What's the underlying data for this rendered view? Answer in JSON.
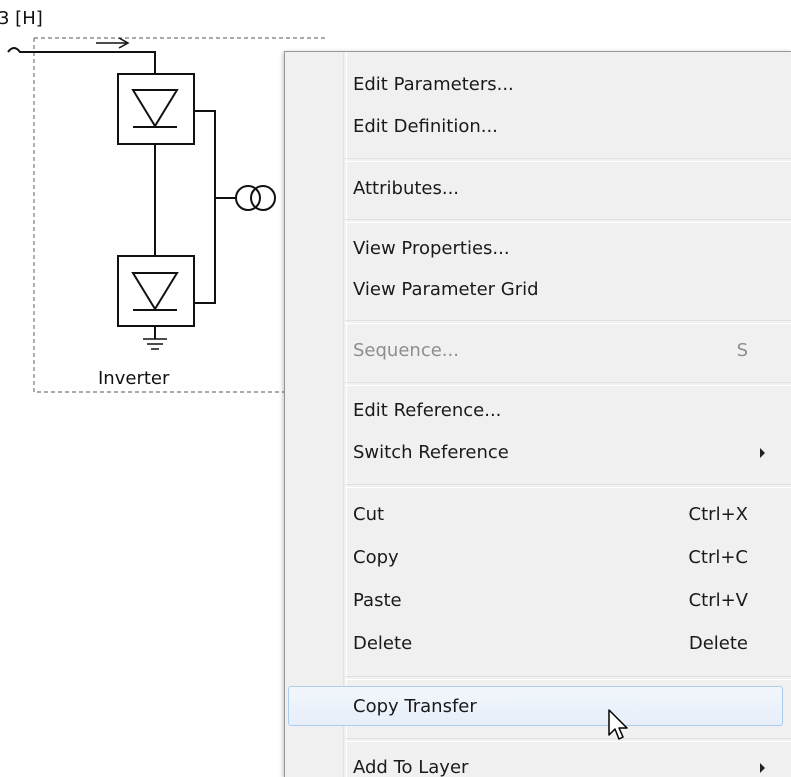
{
  "schematic": {
    "bus_label": "3 [H]",
    "component_label": "Inverter"
  },
  "context_menu": {
    "items": [
      {
        "label": "Edit Parameters...",
        "shortcut": "",
        "enabled": true,
        "submenu": false
      },
      {
        "label": "Edit Definition...",
        "shortcut": "",
        "enabled": true,
        "submenu": false
      },
      {
        "label": "Attributes...",
        "shortcut": "",
        "enabled": true,
        "submenu": false
      },
      {
        "label": "View Properties...",
        "shortcut": "",
        "enabled": true,
        "submenu": false
      },
      {
        "label": "View Parameter Grid",
        "shortcut": "",
        "enabled": true,
        "submenu": false
      },
      {
        "label": "Sequence...",
        "shortcut": "S",
        "enabled": false,
        "submenu": false
      },
      {
        "label": "Edit Reference...",
        "shortcut": "",
        "enabled": true,
        "submenu": false
      },
      {
        "label": "Switch Reference",
        "shortcut": "",
        "enabled": true,
        "submenu": true
      },
      {
        "label": "Cut",
        "shortcut": "Ctrl+X",
        "enabled": true,
        "submenu": false
      },
      {
        "label": "Copy",
        "shortcut": "Ctrl+C",
        "enabled": true,
        "submenu": false
      },
      {
        "label": "Paste",
        "shortcut": "Ctrl+V",
        "enabled": true,
        "submenu": false
      },
      {
        "label": "Delete",
        "shortcut": "Delete",
        "enabled": true,
        "submenu": false
      },
      {
        "label": "Copy Transfer",
        "shortcut": "",
        "enabled": true,
        "submenu": false,
        "highlighted": true
      },
      {
        "label": "Add To Layer",
        "shortcut": "",
        "enabled": true,
        "submenu": true
      }
    ]
  },
  "colors": {
    "menu_background": "#f0f0f0",
    "highlight_border": "#aecbf0",
    "disabled_text": "#8d8d8d"
  }
}
